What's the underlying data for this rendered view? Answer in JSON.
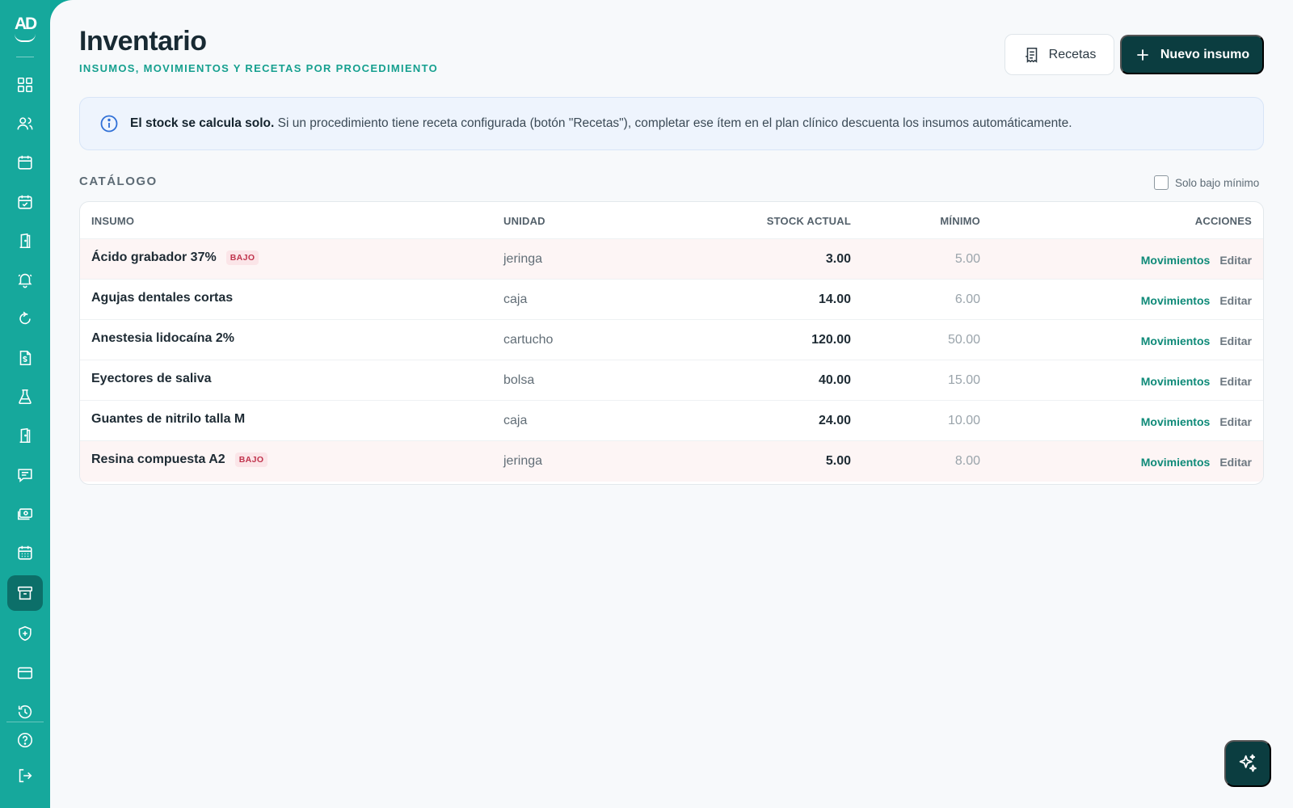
{
  "brand": {
    "logo_text": "AD"
  },
  "sidebar": {
    "items": [
      {
        "icon": "grid-icon"
      },
      {
        "icon": "users-icon"
      },
      {
        "icon": "calendar-icon"
      },
      {
        "icon": "calendar-check-icon"
      },
      {
        "icon": "door-icon"
      },
      {
        "icon": "bell-icon"
      },
      {
        "icon": "refresh-icon"
      },
      {
        "icon": "invoice-icon"
      },
      {
        "icon": "flask-icon"
      },
      {
        "icon": "door-icon"
      },
      {
        "icon": "chat-icon"
      },
      {
        "icon": "money-icon"
      },
      {
        "icon": "calendar-grid-icon"
      },
      {
        "icon": "archive-icon",
        "active": true
      },
      {
        "icon": "shield-plus-icon"
      },
      {
        "icon": "credit-card-icon"
      },
      {
        "icon": "history-icon"
      }
    ],
    "bottom": [
      {
        "icon": "help-icon"
      },
      {
        "icon": "logout-icon"
      }
    ]
  },
  "header": {
    "title": "Inventario",
    "subtitle": "INSUMOS, MOVIMIENTOS Y RECETAS POR PROCEDIMIENTO",
    "recetas_label": "Recetas",
    "nuevo_label": "Nuevo insumo"
  },
  "banner": {
    "bold": "El stock se calcula solo.",
    "text": " Si un procedimiento tiene receta configurada (botón \"Recetas\"), completar ese ítem en el plan clínico descuenta los insumos automáticamente."
  },
  "catalog": {
    "label": "CATÁLOGO",
    "filter_label": "Solo bajo mínimo",
    "filter_checked": false,
    "columns": {
      "insumo": "INSUMO",
      "unidad": "UNIDAD",
      "stock": "STOCK ACTUAL",
      "minimo": "MÍNIMO",
      "acciones": "ACCIONES"
    },
    "badge_label": "BAJO",
    "action_mov": "Movimientos",
    "action_edit": "Editar",
    "rows": [
      {
        "name": "Ácido grabador 37%",
        "unit": "jeringa",
        "stock": "3.00",
        "min": "5.00",
        "low": true
      },
      {
        "name": "Agujas dentales cortas",
        "unit": "caja",
        "stock": "14.00",
        "min": "6.00",
        "low": false
      },
      {
        "name": "Anestesia lidocaína 2%",
        "unit": "cartucho",
        "stock": "120.00",
        "min": "50.00",
        "low": false
      },
      {
        "name": "Eyectores de saliva",
        "unit": "bolsa",
        "stock": "40.00",
        "min": "15.00",
        "low": false
      },
      {
        "name": "Guantes de nitrilo talla M",
        "unit": "caja",
        "stock": "24.00",
        "min": "10.00",
        "low": false
      },
      {
        "name": "Resina compuesta A2",
        "unit": "jeringa",
        "stock": "5.00",
        "min": "8.00",
        "low": true
      }
    ]
  },
  "colors": {
    "sidebar": "#16a89c",
    "accent_dark": "#0b3d40",
    "accent_text": "#16a08f",
    "low_badge": "#c0344d"
  }
}
